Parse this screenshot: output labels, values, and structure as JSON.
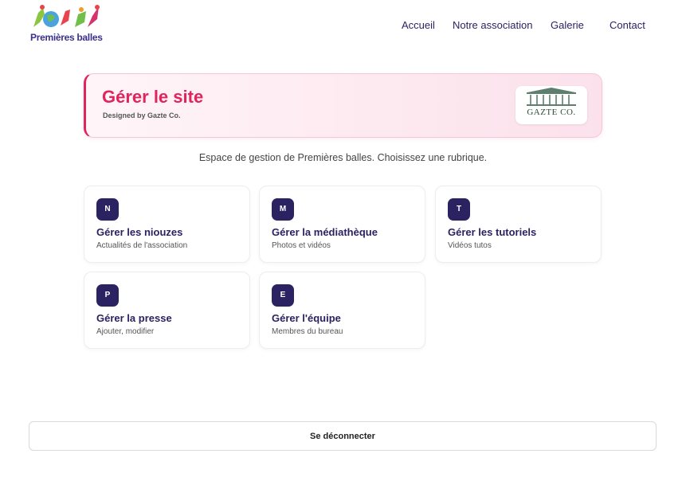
{
  "header": {
    "logo_text": "Premières balles",
    "nav": [
      "Accueil",
      "Notre association",
      "Galerie",
      "Contact"
    ]
  },
  "banner": {
    "title": "Gérer le site",
    "subtitle": "Designed by Gazte Co.",
    "partner_logo_text": "GAZTE CO."
  },
  "intro": "Espace de gestion de Premières balles. Choisissez une rubrique.",
  "cards": [
    {
      "badge": "N",
      "title": "Gérer les niouzes",
      "desc": "Actualités de l'association"
    },
    {
      "badge": "M",
      "title": "Gérer la médiathèque",
      "desc": "Photos et vidéos"
    },
    {
      "badge": "T",
      "title": "Gérer les tutoriels",
      "desc": "Vidéos tutos"
    },
    {
      "badge": "P",
      "title": "Gérer la presse",
      "desc": "Ajouter, modifier"
    },
    {
      "badge": "E",
      "title": "Gérer l'équipe",
      "desc": "Membres du bureau"
    }
  ],
  "logout_label": "Se déconnecter",
  "colors": {
    "brand": "#2b2262",
    "accent": "#e0245e"
  }
}
